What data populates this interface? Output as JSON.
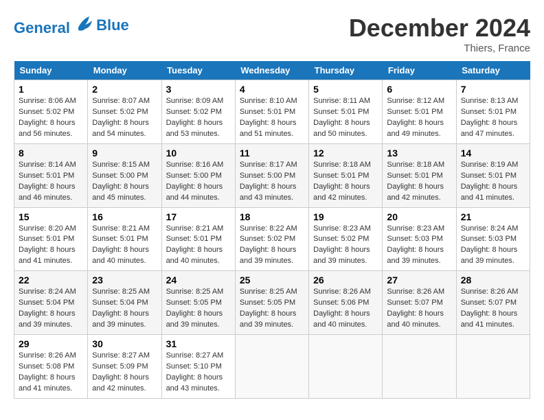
{
  "header": {
    "logo_line1": "General",
    "logo_line2": "Blue",
    "month": "December 2024",
    "location": "Thiers, France"
  },
  "weekdays": [
    "Sunday",
    "Monday",
    "Tuesday",
    "Wednesday",
    "Thursday",
    "Friday",
    "Saturday"
  ],
  "weeks": [
    [
      {
        "day": "1",
        "sunrise": "Sunrise: 8:06 AM",
        "sunset": "Sunset: 5:02 PM",
        "daylight": "Daylight: 8 hours and 56 minutes."
      },
      {
        "day": "2",
        "sunrise": "Sunrise: 8:07 AM",
        "sunset": "Sunset: 5:02 PM",
        "daylight": "Daylight: 8 hours and 54 minutes."
      },
      {
        "day": "3",
        "sunrise": "Sunrise: 8:09 AM",
        "sunset": "Sunset: 5:02 PM",
        "daylight": "Daylight: 8 hours and 53 minutes."
      },
      {
        "day": "4",
        "sunrise": "Sunrise: 8:10 AM",
        "sunset": "Sunset: 5:01 PM",
        "daylight": "Daylight: 8 hours and 51 minutes."
      },
      {
        "day": "5",
        "sunrise": "Sunrise: 8:11 AM",
        "sunset": "Sunset: 5:01 PM",
        "daylight": "Daylight: 8 hours and 50 minutes."
      },
      {
        "day": "6",
        "sunrise": "Sunrise: 8:12 AM",
        "sunset": "Sunset: 5:01 PM",
        "daylight": "Daylight: 8 hours and 49 minutes."
      },
      {
        "day": "7",
        "sunrise": "Sunrise: 8:13 AM",
        "sunset": "Sunset: 5:01 PM",
        "daylight": "Daylight: 8 hours and 47 minutes."
      }
    ],
    [
      {
        "day": "8",
        "sunrise": "Sunrise: 8:14 AM",
        "sunset": "Sunset: 5:01 PM",
        "daylight": "Daylight: 8 hours and 46 minutes."
      },
      {
        "day": "9",
        "sunrise": "Sunrise: 8:15 AM",
        "sunset": "Sunset: 5:00 PM",
        "daylight": "Daylight: 8 hours and 45 minutes."
      },
      {
        "day": "10",
        "sunrise": "Sunrise: 8:16 AM",
        "sunset": "Sunset: 5:00 PM",
        "daylight": "Daylight: 8 hours and 44 minutes."
      },
      {
        "day": "11",
        "sunrise": "Sunrise: 8:17 AM",
        "sunset": "Sunset: 5:00 PM",
        "daylight": "Daylight: 8 hours and 43 minutes."
      },
      {
        "day": "12",
        "sunrise": "Sunrise: 8:18 AM",
        "sunset": "Sunset: 5:01 PM",
        "daylight": "Daylight: 8 hours and 42 minutes."
      },
      {
        "day": "13",
        "sunrise": "Sunrise: 8:18 AM",
        "sunset": "Sunset: 5:01 PM",
        "daylight": "Daylight: 8 hours and 42 minutes."
      },
      {
        "day": "14",
        "sunrise": "Sunrise: 8:19 AM",
        "sunset": "Sunset: 5:01 PM",
        "daylight": "Daylight: 8 hours and 41 minutes."
      }
    ],
    [
      {
        "day": "15",
        "sunrise": "Sunrise: 8:20 AM",
        "sunset": "Sunset: 5:01 PM",
        "daylight": "Daylight: 8 hours and 41 minutes."
      },
      {
        "day": "16",
        "sunrise": "Sunrise: 8:21 AM",
        "sunset": "Sunset: 5:01 PM",
        "daylight": "Daylight: 8 hours and 40 minutes."
      },
      {
        "day": "17",
        "sunrise": "Sunrise: 8:21 AM",
        "sunset": "Sunset: 5:01 PM",
        "daylight": "Daylight: 8 hours and 40 minutes."
      },
      {
        "day": "18",
        "sunrise": "Sunrise: 8:22 AM",
        "sunset": "Sunset: 5:02 PM",
        "daylight": "Daylight: 8 hours and 39 minutes."
      },
      {
        "day": "19",
        "sunrise": "Sunrise: 8:23 AM",
        "sunset": "Sunset: 5:02 PM",
        "daylight": "Daylight: 8 hours and 39 minutes."
      },
      {
        "day": "20",
        "sunrise": "Sunrise: 8:23 AM",
        "sunset": "Sunset: 5:03 PM",
        "daylight": "Daylight: 8 hours and 39 minutes."
      },
      {
        "day": "21",
        "sunrise": "Sunrise: 8:24 AM",
        "sunset": "Sunset: 5:03 PM",
        "daylight": "Daylight: 8 hours and 39 minutes."
      }
    ],
    [
      {
        "day": "22",
        "sunrise": "Sunrise: 8:24 AM",
        "sunset": "Sunset: 5:04 PM",
        "daylight": "Daylight: 8 hours and 39 minutes."
      },
      {
        "day": "23",
        "sunrise": "Sunrise: 8:25 AM",
        "sunset": "Sunset: 5:04 PM",
        "daylight": "Daylight: 8 hours and 39 minutes."
      },
      {
        "day": "24",
        "sunrise": "Sunrise: 8:25 AM",
        "sunset": "Sunset: 5:05 PM",
        "daylight": "Daylight: 8 hours and 39 minutes."
      },
      {
        "day": "25",
        "sunrise": "Sunrise: 8:25 AM",
        "sunset": "Sunset: 5:05 PM",
        "daylight": "Daylight: 8 hours and 39 minutes."
      },
      {
        "day": "26",
        "sunrise": "Sunrise: 8:26 AM",
        "sunset": "Sunset: 5:06 PM",
        "daylight": "Daylight: 8 hours and 40 minutes."
      },
      {
        "day": "27",
        "sunrise": "Sunrise: 8:26 AM",
        "sunset": "Sunset: 5:07 PM",
        "daylight": "Daylight: 8 hours and 40 minutes."
      },
      {
        "day": "28",
        "sunrise": "Sunrise: 8:26 AM",
        "sunset": "Sunset: 5:07 PM",
        "daylight": "Daylight: 8 hours and 41 minutes."
      }
    ],
    [
      {
        "day": "29",
        "sunrise": "Sunrise: 8:26 AM",
        "sunset": "Sunset: 5:08 PM",
        "daylight": "Daylight: 8 hours and 41 minutes."
      },
      {
        "day": "30",
        "sunrise": "Sunrise: 8:27 AM",
        "sunset": "Sunset: 5:09 PM",
        "daylight": "Daylight: 8 hours and 42 minutes."
      },
      {
        "day": "31",
        "sunrise": "Sunrise: 8:27 AM",
        "sunset": "Sunset: 5:10 PM",
        "daylight": "Daylight: 8 hours and 43 minutes."
      },
      null,
      null,
      null,
      null
    ]
  ]
}
